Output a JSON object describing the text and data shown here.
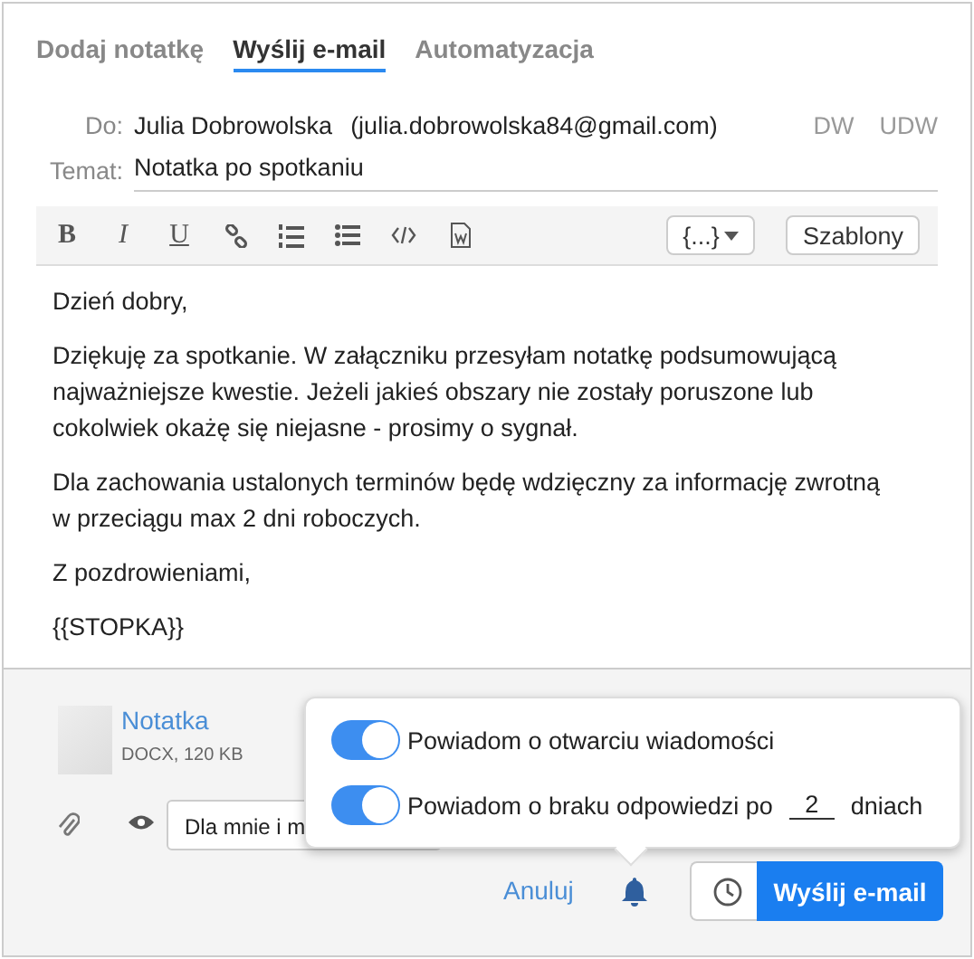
{
  "tabs": [
    {
      "label": "Dodaj notatkę",
      "selected": false
    },
    {
      "label": "Wyślij e-mail",
      "selected": true
    },
    {
      "label": "Automatyzacja",
      "selected": false
    }
  ],
  "to": {
    "label": "Do:",
    "name": "Julia Dobrowolska",
    "email": "(julia.dobrowolska84@gmail.com)",
    "cc": "DW",
    "bcc": "UDW"
  },
  "subject": {
    "label": "Temat:",
    "value": "Notatka po spotkaniu"
  },
  "toolbar": {
    "bold": "B",
    "italic": "I",
    "underline": "U",
    "variables": "{...}",
    "templates": "Szablony"
  },
  "body": [
    "Dzień dobry,",
    "Dziękuję za spotkanie. W załączniku przesyłam notatkę podsumowującą najważniejsze kwestie. Jeżeli jakieś obszary nie zostały poruszone lub cokolwiek okażę się niejasne - prosimy o sygnał.",
    "Dla zachowania ustalonych terminów będę wdzięczny za informację zwrotną w przeciągu max 2 dni roboczych.",
    "Z pozdrowieniami,",
    "{{STOPKA}}"
  ],
  "attachment": {
    "name": "Notatka",
    "info": "DOCX, 120 KB"
  },
  "visibility": {
    "value": "Dla mnie i m"
  },
  "popover": {
    "open_notify": {
      "label": "Powiadom o otwarciu wiadomości",
      "on": true
    },
    "reply_notify": {
      "label": "Powiadom o braku odpowiedzi po",
      "on": true,
      "days": "2",
      "suffix": "dniach"
    }
  },
  "actions": {
    "cancel": "Anuluj",
    "send": "Wyślij e-mail"
  }
}
